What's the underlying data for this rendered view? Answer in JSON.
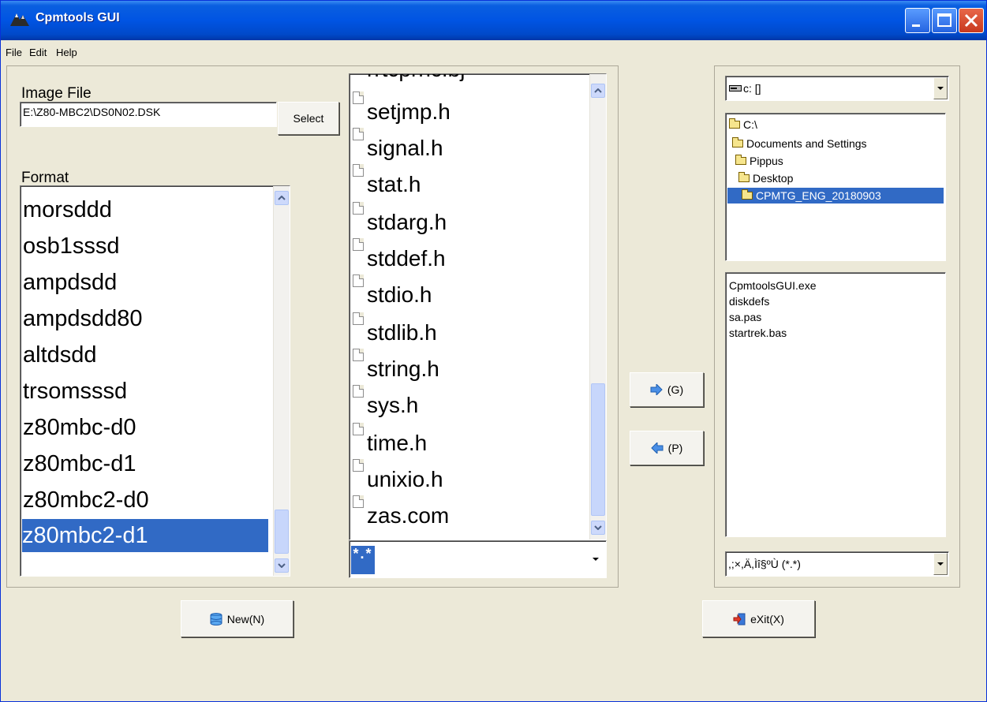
{
  "window": {
    "title": "Cpmtools GUI"
  },
  "menu": [
    "File",
    "Edit",
    "Help"
  ],
  "image_file": {
    "label": "Image File",
    "value": "E:\\Z80-MBC2\\DS0N02.DSK",
    "select_button": "Select"
  },
  "format": {
    "label": "Format",
    "items": [
      "morsddd",
      "osb1sssd",
      "ampdsdd",
      "ampdsdd80",
      "altdsdd",
      "trsomsssd",
      "z80mbc-d0",
      "z80mbc-d1",
      "z80mbc2-d0",
      "z80mbc2-d1"
    ],
    "selected": "z80mbc2-d1"
  },
  "image_files": {
    "items": [
      "setjmp.h",
      "signal.h",
      "stat.h",
      "stdarg.h",
      "stddef.h",
      "stdio.h",
      "stdlib.h",
      "string.h",
      "sys.h",
      "time.h",
      "unixio.h",
      "zas.com"
    ],
    "filter_value": "*.*"
  },
  "transfer": {
    "get_label": "(G)",
    "put_label": "(P)"
  },
  "drive": {
    "value": "c: []"
  },
  "folders": [
    {
      "name": "C:\\",
      "selected": false
    },
    {
      "name": "Documents and Settings",
      "selected": false
    },
    {
      "name": "Pippus",
      "selected": false
    },
    {
      "name": "Desktop",
      "selected": false
    },
    {
      "name": "CPMTG_ENG_20180903",
      "selected": true
    }
  ],
  "local_files": [
    "CpmtoolsGUI.exe",
    "diskdefs",
    "sa.pas",
    "startrek.bas"
  ],
  "local_filter": {
    "value": ",;×,Ä,Ìî§ºÙ (*.*)"
  },
  "buttons": {
    "new": "New(N)",
    "exit": "eXit(X)"
  },
  "colors": {
    "titlebar": "#0054e3",
    "selection": "#316ac5",
    "face": "#ece9d8"
  }
}
